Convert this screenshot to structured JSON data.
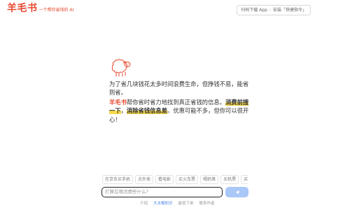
{
  "header": {
    "logo_text": "羊毛书",
    "logo_tagline": "一个帮你省钱的 AI",
    "download_label": "扫码下载 App",
    "shortcut_label": "安装「快捷指令」",
    "separator": "|"
  },
  "mascot": {
    "icon": "sheep-icon"
  },
  "intro": {
    "line1": "为了省几块钱花太多时间浪费生命，但挣钱不易，能省则省。",
    "brand": "羊毛书",
    "text_a": "帮你省时省力地找到真正省钱的信息。",
    "highlight1": "消费前搜一下",
    "text_b": "，",
    "highlight2": "消除省钱信息差",
    "text_c": "。优惠可能不多，但你可以很开心！"
  },
  "chips": [
    "在京东买手机",
    "点外卖",
    "看电影",
    "买火车票",
    "喝奶茶",
    "买机票",
    "买家具"
  ],
  "search": {
    "placeholder": "打算在哪消费些什么？",
    "send_icon": "send-icon"
  },
  "footer": {
    "links": [
      "介绍",
      "大冰棍知识",
      "最低下单",
      "联系作者"
    ]
  },
  "colors": {
    "brand": "#e8492f",
    "highlight": "#f7d94c",
    "send_button": "#a9c7f7",
    "footer_link_active": "#4a86e8"
  }
}
